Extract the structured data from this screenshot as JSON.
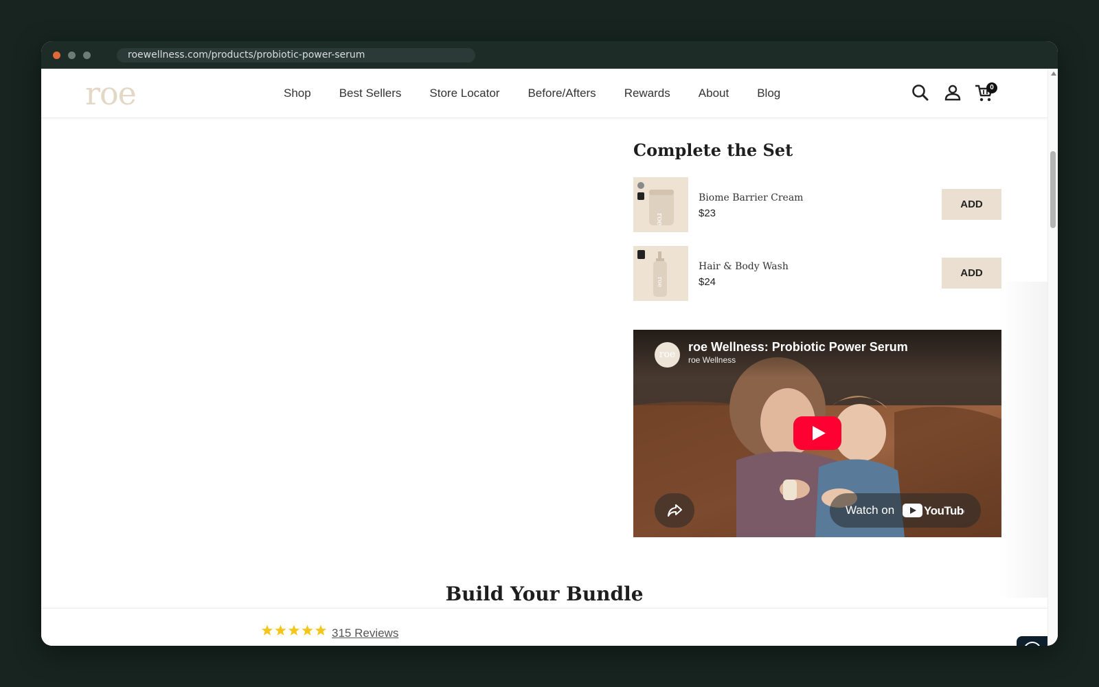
{
  "browser": {
    "url": "roewellness.com/products/probiotic-power-serum"
  },
  "header": {
    "logo": "roe",
    "nav": [
      "Shop",
      "Best Sellers",
      "Store Locator",
      "Before/Afters",
      "Rewards",
      "About",
      "Blog"
    ],
    "cart_count": "0"
  },
  "set": {
    "title": "Complete the Set",
    "items": [
      {
        "name": "Biome Barrier Cream",
        "price": "$23",
        "button": "ADD"
      },
      {
        "name": "Hair & Body Wash",
        "price": "$24",
        "button": "ADD"
      }
    ]
  },
  "video": {
    "title": "roe Wellness: Probiotic Power Serum",
    "channel": "roe Wellness",
    "avatar_text": "roe",
    "watch_on": "Watch on",
    "youtube": "YouTube"
  },
  "bundle": {
    "title": "Build Your Bundle"
  },
  "sticky": {
    "rating_stars": 5,
    "reviews": "315 Reviews"
  },
  "colors": {
    "accent_beige": "#eadfd0",
    "logo_beige": "#e3d7c6",
    "star_gold": "#f5c518",
    "youtube_red": "#ff0033"
  }
}
